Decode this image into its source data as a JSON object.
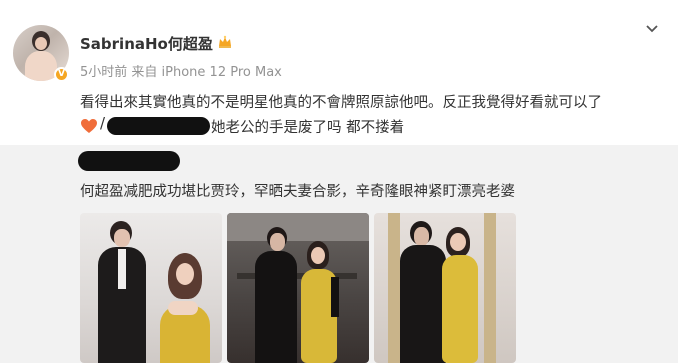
{
  "post": {
    "username": "SabrinaHo何超盈",
    "meta": "5小时前  来自 iPhone 12 Pro Max",
    "verified_badge": "V",
    "line1": "看得出來其實他真的不是明星他真的不會牌照原諒他吧。反正我覺得好看就可以了",
    "line2_slash": "/",
    "line2_text": "她老公的手是废了吗 都不搂着",
    "icons": [
      "avatar",
      "crown-icon",
      "chevron-down-icon",
      "heart-icon"
    ]
  },
  "repost": {
    "text": "何超盈减肥成功堪比贾玲，罕晒夫妻合影，辛奇隆眼神紧盯漂亮老婆",
    "photos": [
      "couple-photo-1",
      "couple-photo-2",
      "couple-photo-3"
    ]
  },
  "colors": {
    "accent_orange": "#f5a623",
    "meta_gray": "#939393",
    "repost_bg": "#f2f2f2"
  }
}
